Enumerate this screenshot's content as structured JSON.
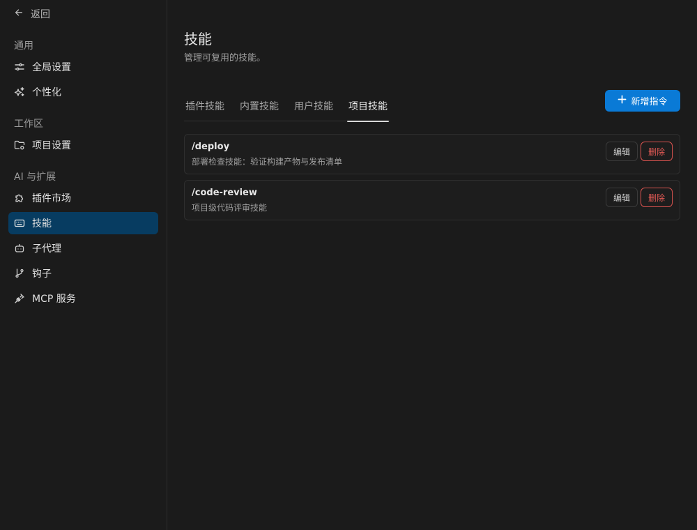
{
  "sidebar": {
    "back_label": "返回",
    "sections": [
      {
        "title": "通用"
      },
      {
        "title": "工作区"
      },
      {
        "title": "AI 与扩展"
      }
    ],
    "items": [
      {
        "label": "全局设置",
        "icon": "sliders-icon"
      },
      {
        "label": "个性化",
        "icon": "sparkle-icon"
      },
      {
        "label": "项目设置",
        "icon": "folder-settings-icon"
      },
      {
        "label": "插件市场",
        "icon": "puzzle-icon"
      },
      {
        "label": "技能",
        "icon": "keyboard-icon",
        "active": true
      },
      {
        "label": "子代理",
        "icon": "bot-icon"
      },
      {
        "label": "钩子",
        "icon": "git-branch-icon"
      },
      {
        "label": "MCP 服务",
        "icon": "plug-icon"
      }
    ]
  },
  "main": {
    "title": "技能",
    "subtitle": "管理可复用的技能。",
    "tabs": [
      {
        "label": "插件技能"
      },
      {
        "label": "内置技能"
      },
      {
        "label": "用户技能"
      },
      {
        "label": "项目技能",
        "active": true
      }
    ],
    "add_button_label": "新增指令",
    "skills": [
      {
        "name": "/deploy",
        "description": "部署检查技能：验证构建产物与发布清单",
        "edit_label": "编辑",
        "delete_label": "删除"
      },
      {
        "name": "/code-review",
        "description": "项目级代码评审技能",
        "edit_label": "编辑",
        "delete_label": "删除"
      }
    ]
  },
  "colors": {
    "background": "#1b1b1b",
    "active_nav": "#073c61",
    "primary": "#0a7ad6",
    "danger": "#e45a55"
  }
}
